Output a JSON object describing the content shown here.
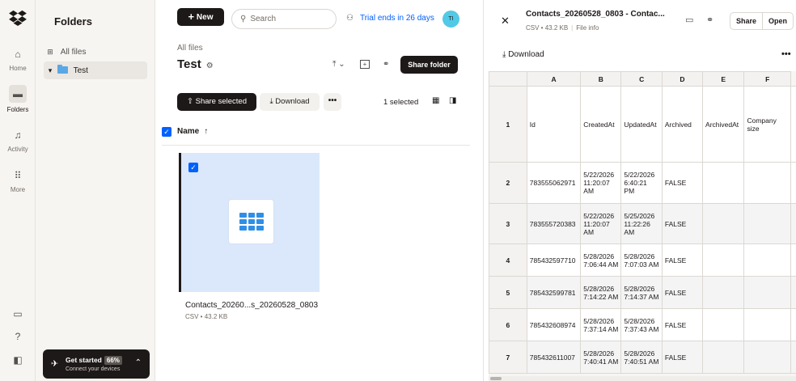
{
  "rail": {
    "items": [
      {
        "label": "Home",
        "icon": "home-icon",
        "glyph": "⌂"
      },
      {
        "label": "Folders",
        "icon": "folders-icon",
        "glyph": "▬"
      },
      {
        "label": "Activity",
        "icon": "bell-icon",
        "glyph": "♫"
      },
      {
        "label": "More",
        "icon": "grid-dots-icon",
        "glyph": "⠿"
      }
    ],
    "bottom": [
      {
        "icon": "desktop-icon",
        "glyph": "▭"
      },
      {
        "icon": "help-icon",
        "glyph": "?"
      },
      {
        "icon": "panel-icon",
        "glyph": "◧"
      }
    ]
  },
  "folders_panel": {
    "title": "Folders",
    "all_files": "All files",
    "test_folder": "Test"
  },
  "get_started": {
    "title": "Get started",
    "percent": "66%",
    "subtitle": "Connect your devices"
  },
  "top": {
    "new_label": "New",
    "search_placeholder": "Search",
    "trial_text": "Trial ends in 26 days",
    "avatar_initials": "TI"
  },
  "folder": {
    "breadcrumb": "All files",
    "title": "Test",
    "share_folder": "Share folder"
  },
  "actions": {
    "share_selected": "Share selected",
    "download": "Download",
    "selected_count": "1 selected"
  },
  "list": {
    "name_header": "Name",
    "file_name": "Contacts_20260...s_20260528_0803",
    "file_meta": "CSV • 43.2 KB"
  },
  "preview": {
    "title": "Contacts_20260528_0803 - Contac...",
    "meta": "CSV • 43.2 KB",
    "file_info": "File info",
    "share": "Share",
    "open": "Open",
    "download": "Download",
    "columns": [
      "A",
      "B",
      "C",
      "D",
      "E",
      "F"
    ],
    "rows": [
      {
        "n": "1",
        "cells": [
          "Id",
          "CreatedAt",
          "UpdatedAt",
          "Archived",
          "ArchivedAt",
          "Company size"
        ]
      },
      {
        "n": "2",
        "cells": [
          "783555062971",
          "5/22/2026 11:20:07 AM",
          "5/22/2026 6:40:21 PM",
          "FALSE",
          "",
          ""
        ]
      },
      {
        "n": "3",
        "cells": [
          "783555720383",
          "5/22/2026 11:20:07 AM",
          "5/25/2026 11:22:26 AM",
          "FALSE",
          "",
          ""
        ]
      },
      {
        "n": "4",
        "cells": [
          "785432597710",
          "5/28/2026 7:06:44 AM",
          "5/28/2026 7:07:03 AM",
          "FALSE",
          "",
          ""
        ]
      },
      {
        "n": "5",
        "cells": [
          "785432599781",
          "5/28/2026 7:14:22 AM",
          "5/28/2026 7:14:37 AM",
          "FALSE",
          "",
          ""
        ]
      },
      {
        "n": "6",
        "cells": [
          "785432608974",
          "5/28/2026 7:37:14 AM",
          "5/28/2026 7:37:43 AM",
          "FALSE",
          "",
          ""
        ]
      },
      {
        "n": "7",
        "cells": [
          "785432611007",
          "5/28/2026 7:40:41 AM",
          "5/28/2026 7:40:51 AM",
          "FALSE",
          "",
          ""
        ]
      }
    ]
  }
}
